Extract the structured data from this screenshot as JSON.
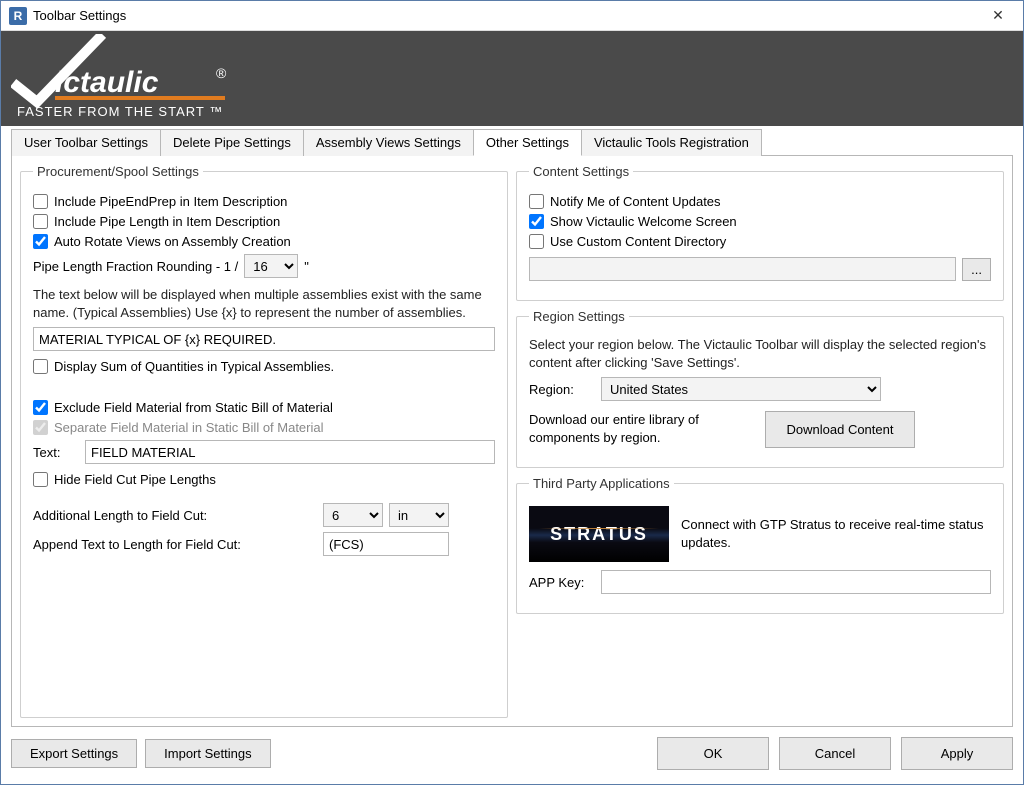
{
  "window": {
    "app_icon_letter": "R",
    "title": "Toolbar Settings"
  },
  "banner": {
    "brand": "Victaulic",
    "tagline": "FASTER FROM THE START ™"
  },
  "tabs": {
    "user_toolbar": "User Toolbar Settings",
    "delete_pipe": "Delete Pipe Settings",
    "assembly_views": "Assembly Views Settings",
    "other": "Other Settings",
    "registration": "Victaulic Tools Registration"
  },
  "procurement": {
    "legend": "Procurement/Spool Settings",
    "include_pipeendprep": {
      "label": "Include PipeEndPrep in Item Description",
      "checked": false
    },
    "include_pipe_length": {
      "label": "Include Pipe Length in Item Description",
      "checked": false
    },
    "auto_rotate": {
      "label": "Auto Rotate Views on Assembly Creation",
      "checked": true
    },
    "fraction_label_prefix": "Pipe Length Fraction Rounding - 1 /",
    "fraction_value": "16",
    "fraction_quote": "\"",
    "multi_assembly_note": "The text below will be displayed when multiple assemblies exist with the same name.  (Typical Assemblies)  Use {x} to represent the number of assemblies.",
    "typical_text": "MATERIAL TYPICAL OF {x} REQUIRED.",
    "display_sum": {
      "label": "Display Sum of Quantities in Typical Assemblies.",
      "checked": false
    },
    "exclude_field": {
      "label": "Exclude Field Material from Static Bill of Material",
      "checked": true
    },
    "separate_field": {
      "label": "Separate Field Material in Static Bill of Material",
      "checked": true,
      "disabled": true
    },
    "text_label": "Text:",
    "text_value": "FIELD MATERIAL",
    "hide_field_cut": {
      "label": "Hide Field Cut Pipe Lengths",
      "checked": false
    },
    "addl_length_label": "Additional Length to Field Cut:",
    "addl_length_value": "6",
    "addl_length_unit": "in",
    "append_text_label": "Append Text to Length for Field Cut:",
    "append_text_value": "(FCS)"
  },
  "content_settings": {
    "legend": "Content Settings",
    "notify": {
      "label": "Notify Me of Content Updates",
      "checked": false
    },
    "welcome": {
      "label": "Show Victaulic Welcome Screen",
      "checked": true
    },
    "custom_dir": {
      "label": "Use Custom Content Directory",
      "checked": false
    },
    "dir_value": "",
    "browse": "..."
  },
  "region": {
    "legend": "Region Settings",
    "desc": "Select your region below.  The Victaulic Toolbar will display the selected region's content after clicking 'Save Settings'.",
    "label": "Region:",
    "value": "United States",
    "download_desc": "Download our entire library of components by region.",
    "download_btn": "Download Content"
  },
  "third_party": {
    "legend": "Third Party Applications",
    "stratus_name": "STRATUS",
    "stratus_desc": "Connect with GTP Stratus to receive real-time status updates.",
    "app_key_label": "APP Key:",
    "app_key_value": ""
  },
  "footer": {
    "export": "Export Settings",
    "import": "Import Settings",
    "ok": "OK",
    "cancel": "Cancel",
    "apply": "Apply"
  }
}
